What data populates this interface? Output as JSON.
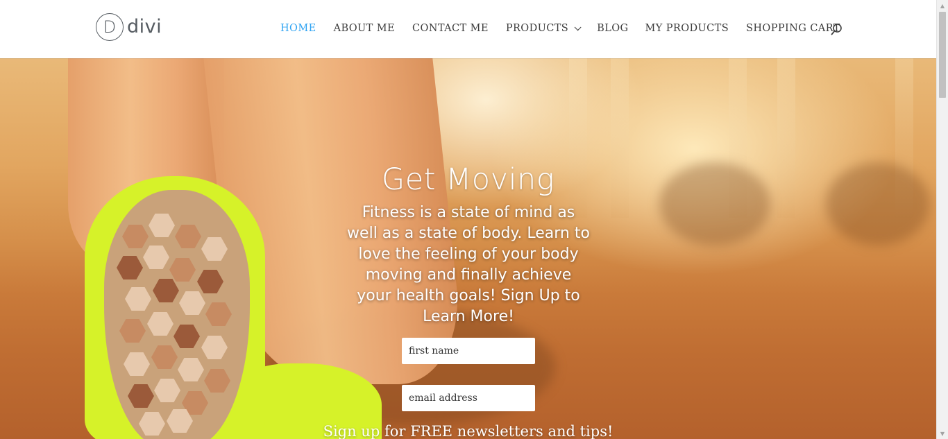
{
  "site": {
    "logo_letter": "D",
    "logo_text": "divi"
  },
  "nav": {
    "items": [
      {
        "label": "HOME",
        "active": true
      },
      {
        "label": "ABOUT ME",
        "active": false
      },
      {
        "label": "CONTACT ME",
        "active": false
      },
      {
        "label": "PRODUCTS",
        "active": false,
        "has_dropdown": true
      },
      {
        "label": "BLOG",
        "active": false
      },
      {
        "label": "MY PRODUCTS",
        "active": false
      },
      {
        "label": "SHOPPING CART",
        "active": false
      }
    ],
    "search_icon": "search-icon"
  },
  "hero": {
    "title": "Get Moving",
    "subtitle": "Fitness is a state of mind as well as a state of body. Learn to love the feeling of your body moving and finally achieve your health goals! Sign Up to Learn More!",
    "first_name_placeholder": "first name",
    "email_placeholder": "email address",
    "note": "Sign up for FREE newsletters and tips!"
  },
  "colors": {
    "accent": "#2ea3f2",
    "nav_text": "#3c3c3c"
  }
}
